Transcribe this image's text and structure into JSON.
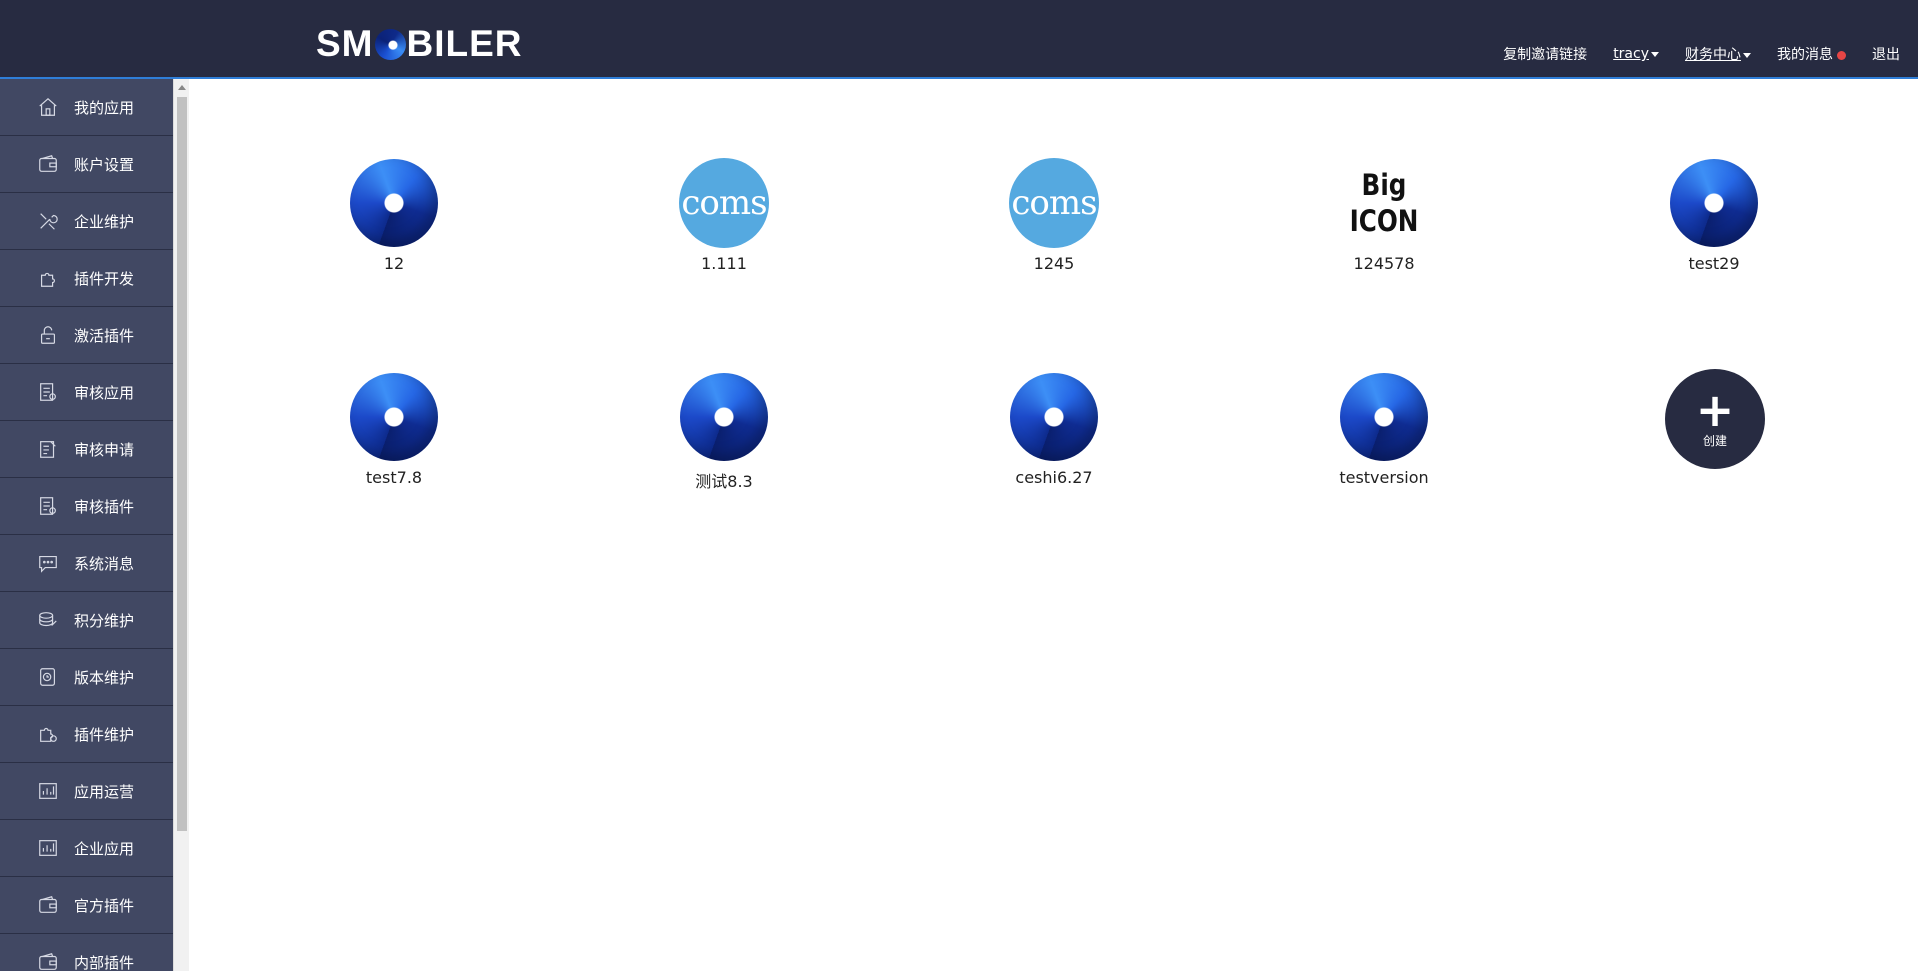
{
  "header": {
    "logo": {
      "left": "SM",
      "right": "BILER"
    },
    "nav": {
      "copy_invite": "复制邀请链接",
      "user": "tracy",
      "finance": "财务中心",
      "messages": "我的消息",
      "logout": "退出"
    }
  },
  "sidebar": {
    "items": [
      {
        "label": "我的应用",
        "icon": "home-icon"
      },
      {
        "label": "账户设置",
        "icon": "wallet-icon"
      },
      {
        "label": "企业维护",
        "icon": "tools-icon"
      },
      {
        "label": "插件开发",
        "icon": "plugin-dev-icon"
      },
      {
        "label": "激活插件",
        "icon": "unlock-icon"
      },
      {
        "label": "审核应用",
        "icon": "doc-review-icon"
      },
      {
        "label": "审核申请",
        "icon": "edit-doc-icon"
      },
      {
        "label": "审核插件",
        "icon": "doc-review-icon"
      },
      {
        "label": "系统消息",
        "icon": "chat-icon"
      },
      {
        "label": "积分维护",
        "icon": "coins-icon"
      },
      {
        "label": "版本维护",
        "icon": "version-icon"
      },
      {
        "label": "插件维护",
        "icon": "puzzle-gear-icon"
      },
      {
        "label": "应用运营",
        "icon": "chart-icon"
      },
      {
        "label": "企业应用",
        "icon": "chart-icon"
      },
      {
        "label": "官方插件",
        "icon": "wallet-icon"
      },
      {
        "label": "内部插件",
        "icon": "wallet-icon"
      }
    ]
  },
  "apps": [
    {
      "name": "12",
      "icon": "smobiler-swirl-icon"
    },
    {
      "name": "1.111",
      "icon": "coms-icon",
      "icon_text": "coms"
    },
    {
      "name": "1245",
      "icon": "coms-icon",
      "icon_text": "coms"
    },
    {
      "name": "124578",
      "icon": "big-icon",
      "icon_text": [
        "Big",
        "ICON"
      ]
    },
    {
      "name": "test29",
      "icon": "smobiler-swirl-icon"
    },
    {
      "name": "test7.8",
      "icon": "smobiler-swirl-icon"
    },
    {
      "name": "测试8.3",
      "icon": "smobiler-swirl-icon"
    },
    {
      "name": "ceshi6.27",
      "icon": "smobiler-swirl-icon"
    },
    {
      "name": "testversion",
      "icon": "smobiler-swirl-icon"
    }
  ],
  "create": {
    "label": "创建",
    "symbol": "+"
  },
  "colors": {
    "header_bg": "#272b41",
    "sidebar_bg": "#414863",
    "accent_line": "#2f7ed8",
    "coms_blue": "#55a9e0",
    "notify_dot": "#e64545"
  }
}
